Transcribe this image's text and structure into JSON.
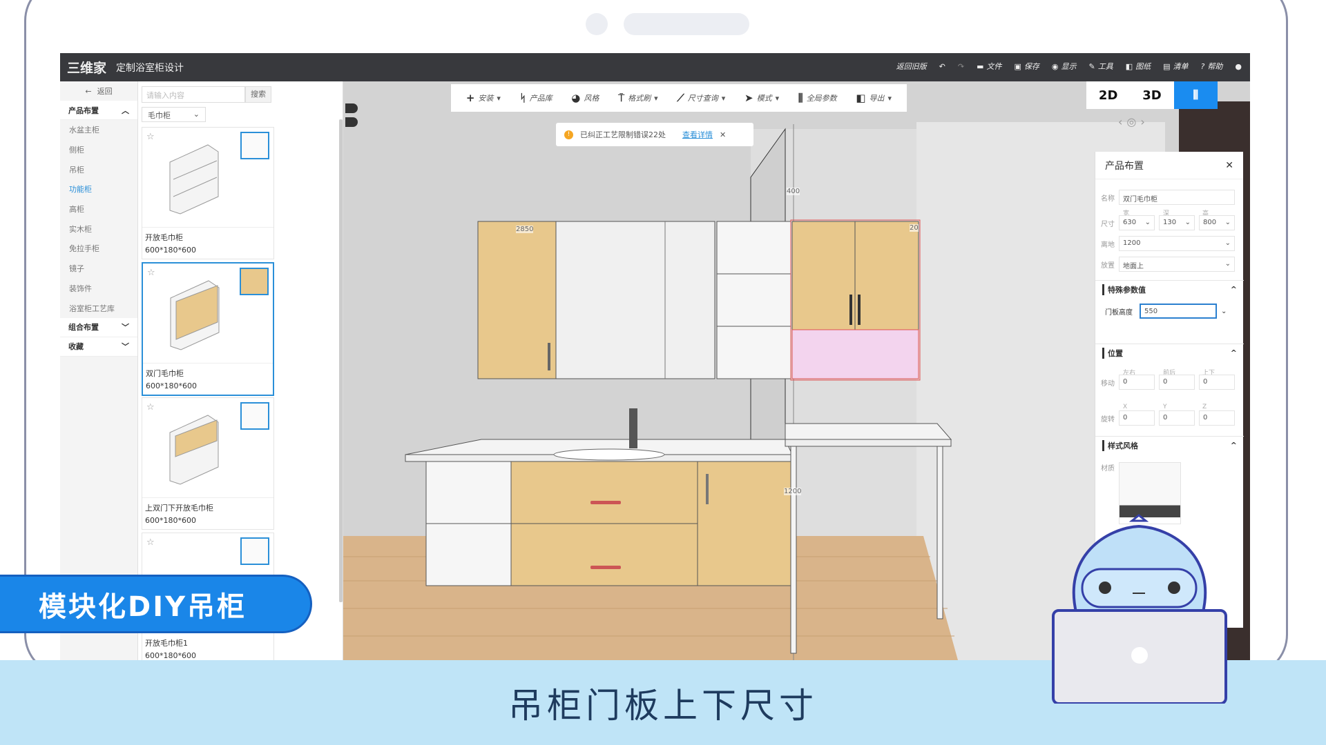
{
  "app": {
    "logo": "三维家",
    "title": "定制浴室柜设计"
  },
  "topmenu": [
    {
      "label": "返回旧版",
      "icon": ""
    },
    {
      "label": "",
      "icon": "undo-icon"
    },
    {
      "label": "",
      "icon": "redo-icon"
    },
    {
      "label": "文件",
      "icon": "folder-icon"
    },
    {
      "label": "保存",
      "icon": "save-icon"
    },
    {
      "label": "显示",
      "icon": "eye-icon"
    },
    {
      "label": "工具",
      "icon": "wrench-icon"
    },
    {
      "label": "图纸",
      "icon": "map-icon"
    },
    {
      "label": "清单",
      "icon": "list-icon"
    },
    {
      "label": "帮助",
      "icon": "help-icon"
    },
    {
      "label": "",
      "icon": "user-icon"
    }
  ],
  "nav": {
    "back": "返回",
    "sections": [
      {
        "label": "产品布置",
        "expanded": true
      },
      {
        "label": "组合布置"
      },
      {
        "label": "收藏"
      }
    ],
    "items": [
      "水盆主柜",
      "侧柜",
      "吊柜",
      "功能柜",
      "高柜",
      "实木柜",
      "免拉手柜",
      "镜子",
      "装饰件",
      "浴室柜工艺库"
    ],
    "active": "功能柜"
  },
  "list": {
    "search_placeholder": "请输入内容",
    "search_button": "搜索",
    "category": "毛巾柜",
    "cards": [
      {
        "name": "开放毛巾柜",
        "size": "600*180*600"
      },
      {
        "name": "双门毛巾柜",
        "size": "600*180*600",
        "selected": true
      },
      {
        "name": "上双门下开放毛巾柜",
        "size": "600*180*600"
      },
      {
        "name": "开放毛巾柜1",
        "size": "600*180*600"
      }
    ]
  },
  "toolbar": [
    "安装",
    "产品库",
    "风格",
    "格式刷",
    "尺寸查询",
    "模式",
    "全局参数",
    "导出"
  ],
  "notice": {
    "text": "已纠正工艺限制错误22处",
    "link": "查看详情"
  },
  "view": {
    "options": [
      "2D",
      "3D"
    ],
    "active": "split"
  },
  "dimensions": {
    "top": "400",
    "width": "2850",
    "gap": "20",
    "height": "1200"
  },
  "panel": {
    "title": "产品布置",
    "name_label": "名称",
    "name": "双门毛巾柜",
    "size_label": "尺寸",
    "width_label": "宽",
    "depth_label": "深",
    "height_label": "高",
    "width": "630",
    "depth": "130",
    "height": "800",
    "elev_label": "离地",
    "elev": "1200",
    "place_label": "放置",
    "place": "地面上",
    "special": "特殊参数值",
    "door_label": "门板高度",
    "door_height": "550",
    "position": "位置",
    "move_label": "移动",
    "lr": "左右",
    "fb": "前后",
    "ud": "上下",
    "move": [
      "0",
      "0",
      "0"
    ],
    "rot_label": "旋转",
    "x": "X",
    "y": "Y",
    "z": "Z",
    "rot": [
      "0",
      "0",
      "0"
    ],
    "style": "样式风格",
    "material_label": "材质"
  },
  "banner": "模块化DIY吊柜",
  "caption": "吊柜门板上下尺寸",
  "colors": {
    "accent": "#1a8cf0",
    "banner": "#1a86e8",
    "caption_bg": "#bfe4f7",
    "wood": "#e8c88c",
    "selected_pink": "#f3d4ee"
  }
}
